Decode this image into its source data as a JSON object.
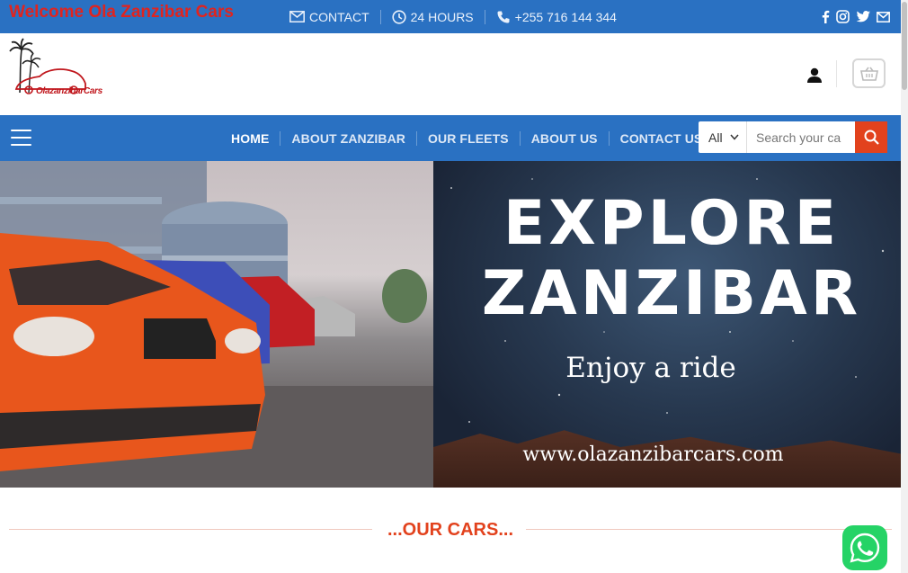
{
  "topbar": {
    "welcome": "Welcome Ola Zanzibar Cars",
    "contact_label": "CONTACT",
    "hours_label": "24 HOURS",
    "phone_label": "+255 716 144 344",
    "socials": [
      "facebook-icon",
      "instagram-icon",
      "twitter-icon",
      "mail-icon"
    ]
  },
  "header": {
    "logo_text": "OlazanzibarCars"
  },
  "nav": {
    "items": [
      {
        "label": "HOME",
        "active": true
      },
      {
        "label": "ABOUT ZANZIBAR",
        "active": false
      },
      {
        "label": "OUR FLEETS",
        "active": false
      },
      {
        "label": "ABOUT US",
        "active": false
      },
      {
        "label": "CONTACT US",
        "active": false
      }
    ],
    "search": {
      "category": "All",
      "placeholder": "Search your ca"
    }
  },
  "hero": {
    "line1": "EXPLORE",
    "line2": "ZANZIBAR",
    "tagline": "Enjoy a ride",
    "website": "www.olazanzibarcars.com"
  },
  "section": {
    "title": "...OUR CARS..."
  },
  "colors": {
    "brand_blue": "#2a71c2",
    "accent_red": "#e2421d",
    "whatsapp_green": "#25d366"
  }
}
